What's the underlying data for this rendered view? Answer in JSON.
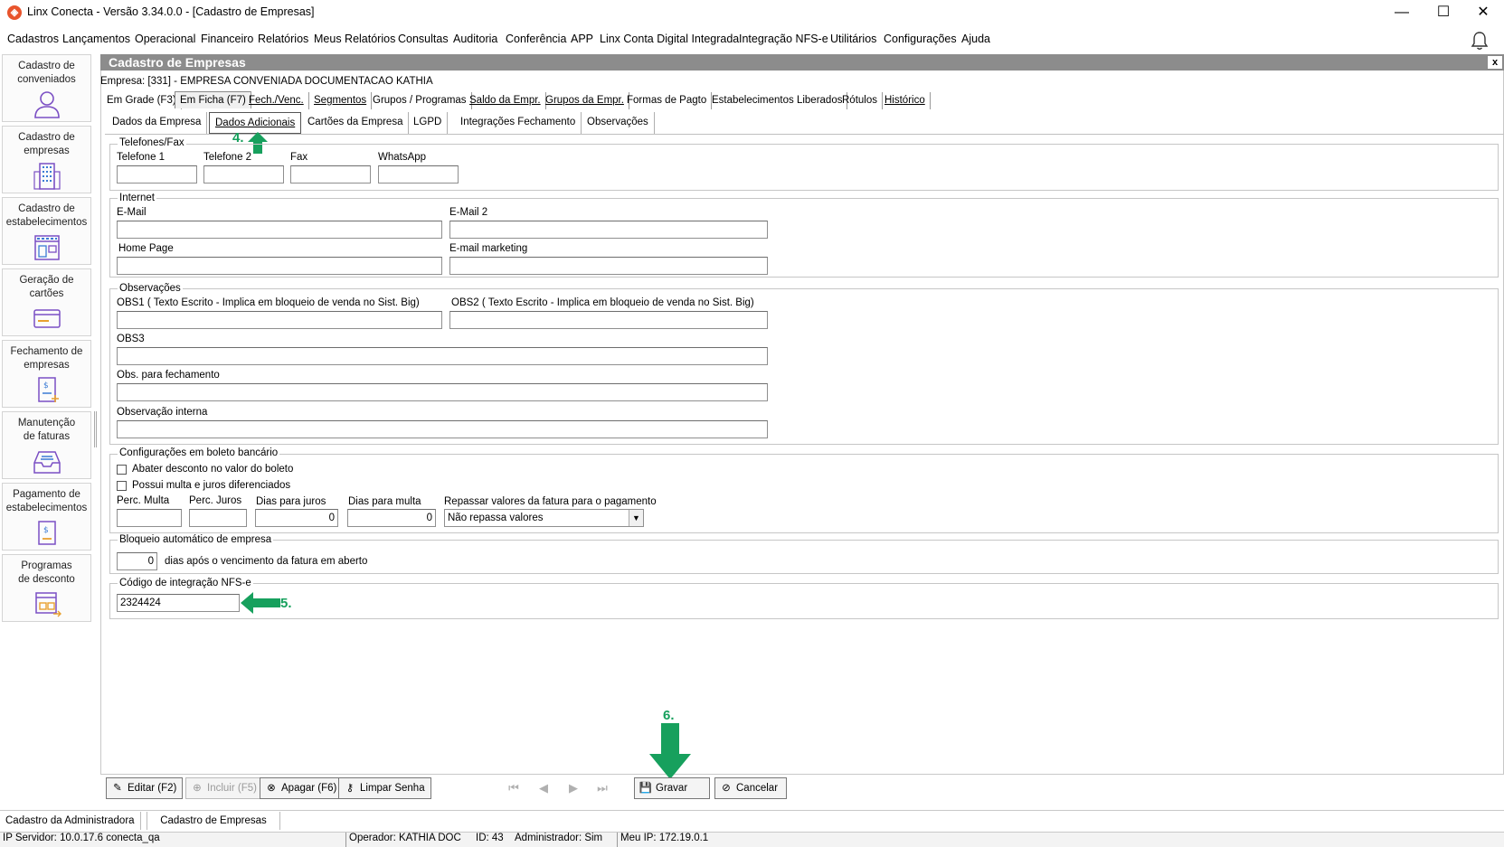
{
  "window": {
    "app_icon": "linx-logo-icon",
    "title": "Linx Conecta - Versão 3.34.0.0 - [Cadastro de Empresas]",
    "minimize": "—",
    "maximize": "☐",
    "close": "✕"
  },
  "menu": [
    "Cadastros",
    "Lançamentos",
    "Operacional",
    "Financeiro",
    "Relatórios",
    "Meus Relatórios",
    "Consultas",
    "Auditoria",
    "Conferência",
    "APP",
    "Linx Conta Digital Integrada",
    "Integração NFS-e",
    "Utilitários",
    "Configurações",
    "Ajuda"
  ],
  "bell_icon": "🔔",
  "sidebar": [
    {
      "l1": "Cadastro de",
      "l2": "conveniados",
      "icon": "person-icon"
    },
    {
      "l1": "Cadastro de",
      "l2": "empresas",
      "icon": "building-icon"
    },
    {
      "l1": "Cadastro de",
      "l2": "estabelecimentos",
      "icon": "store-icon"
    },
    {
      "l1": "Geração de",
      "l2": "cartões",
      "icon": "card-icon"
    },
    {
      "l1": "Fechamento de",
      "l2": "empresas",
      "icon": "invoice-icon"
    },
    {
      "l1": "Manutenção",
      "l2": "de faturas",
      "icon": "inbox-icon"
    },
    {
      "l1": "Pagamento de",
      "l2": "estabelecimentos",
      "icon": "payment-icon"
    },
    {
      "l1": "Programas",
      "l2": "de desconto",
      "icon": "discount-icon"
    }
  ],
  "form": {
    "title": "Cadastro de Empresas",
    "close": "x",
    "empresa": "Empresa: [331] - EMPRESA CONVENIADA DOCUMENTACAO KATHIA",
    "tabs1": [
      "Em Grade (F3)",
      "Em Ficha (F7)",
      "Fech./Venc.",
      "Segmentos",
      "Grupos / Programas",
      "Saldo da Empr.",
      "Grupos da Empr.",
      "Formas de Pagto",
      "Estabelecimentos Liberados",
      "Rótulos",
      "Histórico"
    ],
    "tabs2": [
      "Dados da Empresa",
      "Dados Adicionais",
      "Cartões da Empresa",
      "LGPD",
      "Integrações Fechamento",
      "Observações"
    ]
  },
  "telefones": {
    "title": "Telefones/Fax",
    "fields": [
      "Telefone 1",
      "Telefone 2",
      "Fax",
      "WhatsApp"
    ]
  },
  "internet": {
    "title": "Internet",
    "email": "E-Mail",
    "email2": "E-Mail 2",
    "homepage": "Home Page",
    "email_marketing": "E-mail marketing"
  },
  "observacoes": {
    "title": "Observações",
    "obs1": "OBS1 ( Texto Escrito - Implica em bloqueio de venda no Sist. Big)",
    "obs2": "OBS2 ( Texto Escrito - Implica em bloqueio de venda no Sist. Big)",
    "obs3": "OBS3",
    "obs_fechamento": "Obs. para fechamento",
    "obs_interna": "Observação interna"
  },
  "boleto": {
    "title": "Configurações em boleto bancário",
    "chk1": "Abater desconto no valor do boleto",
    "chk2": "Possui multa e juros diferenciados",
    "perc_multa": "Perc. Multa",
    "perc_juros": "Perc. Juros",
    "dias_juros": "Dias para juros",
    "dias_juros_value": "0",
    "dias_multa": "Dias para multa",
    "dias_multa_value": "0",
    "repassar": "Repassar valores da fatura para o pagamento",
    "repassar_value": "Não repassa valores"
  },
  "bloqueio": {
    "title": "Bloqueio automático de empresa",
    "value": "0",
    "suffix": "dias após o vencimento da fatura em aberto"
  },
  "nfse": {
    "title": "Código de integração NFS-e",
    "value": "2324424"
  },
  "annotations": {
    "a4": "4.",
    "a5": "5.",
    "a6": "6.",
    "color": "#17a05d"
  },
  "buttons": {
    "editar": "Editar (F2)",
    "incluir": "Incluir (F5)",
    "apagar": "Apagar (F6)",
    "limpar": "Limpar Senha",
    "gravar": "Gravar",
    "cancelar": "Cancelar",
    "first": "⏮",
    "prev": "◀",
    "next": "▶",
    "last": "⏭"
  },
  "bottom_tabs": [
    "Cadastro da Administradora",
    "Cadastro de Empresas"
  ],
  "status": {
    "servidor": "IP Servidor: 10.0.17.6 conecta_qa",
    "operador": "Operador: KATHIA DOC",
    "id": "ID: 43",
    "admin": "Administrador: Sim",
    "meu_ip": "Meu IP: 172.19.0.1"
  }
}
